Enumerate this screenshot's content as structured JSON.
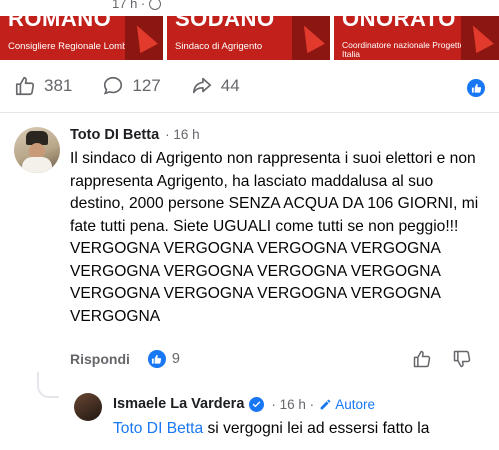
{
  "post": {
    "time": "17 h ·",
    "globe_icon": "globe-icon"
  },
  "banners": [
    {
      "name": "ROMANO",
      "role": "Consigliere Regionale Lombardia"
    },
    {
      "name": "SODANO",
      "role": "Sindaco di Agrigento"
    },
    {
      "name": "ONORATO",
      "role": "Coordinatore nazionale Progetto Civico Italia\nAssessore grandi eventi Comune di Roma"
    }
  ],
  "reactions": {
    "likes": "381",
    "comments": "127",
    "shares": "44"
  },
  "comment": {
    "author": "Toto DI Betta",
    "time": "· 16 h",
    "text": "Il sindaco di Agrigento non rappresenta i suoi elettori e non rappresenta Agrigento, ha lasciato maddalusa al suo destino, 2000  persone SENZA ACQUA DA 106 GIORNI, mi fate tutti pena. Siete UGUALI come tutti se non peggio!!! VERGOGNA VERGOGNA VERGOGNA VERGOGNA VERGOGNA VERGOGNA VERGOGNA VERGOGNA VERGOGNA VERGOGNA VERGOGNA VERGOGNA VERGOGNA",
    "reply_label": "Rispondi",
    "like_count": "9"
  },
  "reply": {
    "author": "Ismaele La Vardera",
    "time": "· 16 h ·",
    "role": "Autore",
    "mention": "Toto DI Betta",
    "text": " si vergogni lei ad essersi fatto la"
  },
  "colors": {
    "accent": "#1877f2",
    "banner_red": "#c2201b",
    "muted": "#65676b"
  }
}
